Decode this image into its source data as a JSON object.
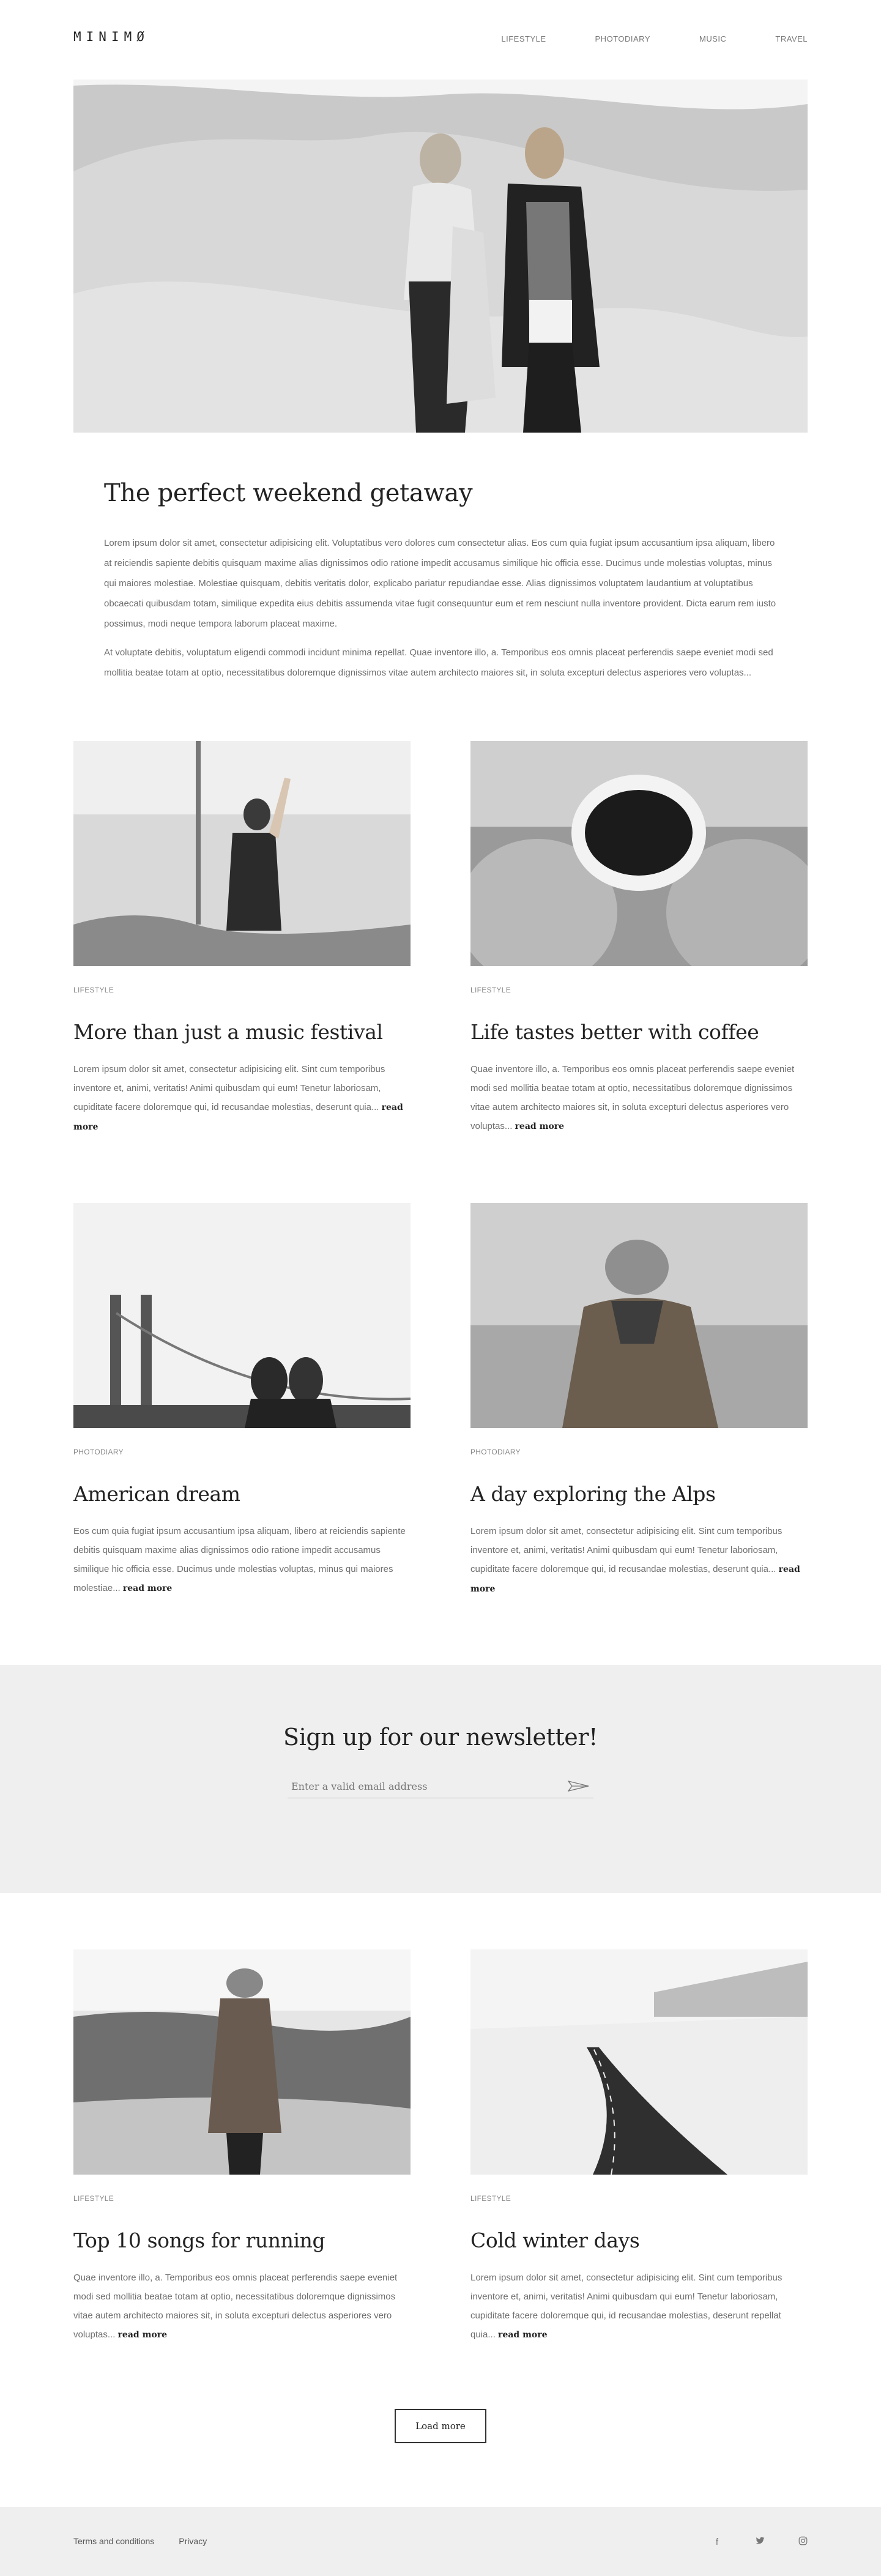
{
  "site": {
    "logo": "MINIMØ"
  },
  "nav": {
    "items": [
      "LIFESTYLE",
      "PHOTODIARY",
      "MUSIC",
      "TRAVEL"
    ]
  },
  "featured": {
    "title": "The perfect weekend getaway",
    "paragraphs": [
      "Lorem ipsum dolor sit amet, consectetur adipisicing elit. Voluptatibus vero dolores cum consectetur alias. Eos cum quia fugiat ipsum accusantium ipsa aliquam, libero at reiciendis sapiente debitis quisquam maxime alias dignissimos odio ratione impedit accusamus similique hic officia esse. Ducimus unde molestias voluptas, minus qui maiores molestiae. Molestiae quisquam, debitis veritatis dolor, explicabo pariatur repudiandae esse. Alias dignissimos voluptatem laudantium at voluptatibus obcaecati quibusdam totam, similique expedita eius debitis assumenda vitae fugit consequuntur eum et rem nesciunt nulla inventore provident. Dicta earum rem iusto possimus, modi neque tempora laborum placeat maxime.",
      "At voluptate debitis, voluptatum eligendi commodi incidunt minima repellat. Quae inventore illo, a. Temporibus eos omnis placeat perferendis saepe eveniet modi sed mollitia beatae totam at optio, necessitatibus doloremque dignissimos vitae autem architecto maiores sit, in soluta excepturi delectus asperiores vero voluptas..."
    ]
  },
  "read_more_label": "read more",
  "articles": [
    {
      "category": "LIFESTYLE",
      "title": "More than just a music festival",
      "excerpt": "Lorem ipsum dolor sit amet, consectetur adipisicing elit. Sint cum temporibus inventore et, animi, veritatis! Animi quibusdam qui eum! Tenetur laboriosam, cupiditate facere doloremque qui, id recusandae molestias, deserunt quia..."
    },
    {
      "category": "LIFESTYLE",
      "title": "Life tastes better with coffee",
      "excerpt": "Quae inventore illo, a. Temporibus eos omnis placeat perferendis saepe eveniet modi sed mollitia beatae totam at optio, necessitatibus doloremque dignissimos vitae autem architecto maiores sit, in soluta excepturi delectus asperiores vero voluptas..."
    },
    {
      "category": "PHOTODIARY",
      "title": "American dream",
      "excerpt": "Eos cum quia fugiat ipsum accusantium ipsa aliquam, libero at reiciendis sapiente debitis quisquam maxime alias dignissimos odio ratione impedit accusamus similique hic officia esse. Ducimus unde molestias voluptas, minus qui maiores molestiae..."
    },
    {
      "category": "PHOTODIARY",
      "title": "A day exploring the Alps",
      "excerpt": "Lorem ipsum dolor sit amet, consectetur adipisicing elit. Sint cum temporibus inventore et, animi, veritatis! Animi quibusdam qui eum! Tenetur laboriosam, cupiditate facere doloremque qui, id recusandae molestias, deserunt quia..."
    },
    {
      "category": "LIFESTYLE",
      "title": "Top 10 songs for running",
      "excerpt": "Quae inventore illo, a. Temporibus eos omnis placeat perferendis saepe eveniet modi sed mollitia beatae totam at optio, necessitatibus doloremque dignissimos vitae autem architecto maiores sit, in soluta excepturi delectus asperiores vero voluptas..."
    },
    {
      "category": "LIFESTYLE",
      "title": "Cold winter days",
      "excerpt": "Lorem ipsum dolor sit amet, consectetur adipisicing elit. Sint cum temporibus inventore et, animi, veritatis! Animi quibusdam qui eum! Tenetur laboriosam, cupiditate facere doloremque qui, id recusandae molestias, deserunt repellat quia..."
    }
  ],
  "newsletter": {
    "title": "Sign up for our newsletter!",
    "placeholder": "Enter a valid email address",
    "send_icon": "paper-plane-icon"
  },
  "load_more_label": "Load more",
  "footer": {
    "links": [
      "Terms and conditions",
      "Privacy"
    ],
    "social": [
      {
        "icon": "facebook-icon",
        "glyph": "f"
      },
      {
        "icon": "twitter-icon",
        "glyph": "🐦"
      },
      {
        "icon": "instagram-icon",
        "glyph": "◎"
      }
    ]
  },
  "colors": {
    "text": "#333333",
    "muted": "#6e6e6e",
    "band": "#efefef"
  }
}
